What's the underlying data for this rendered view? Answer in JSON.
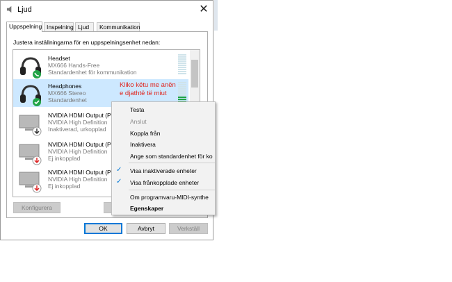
{
  "window": {
    "title": "Ljud",
    "close_glyph": "✕"
  },
  "tabs": [
    {
      "label": "Uppspelning",
      "active": true
    },
    {
      "label": "Inspelning",
      "active": false
    },
    {
      "label": "Ljud",
      "active": false
    },
    {
      "label": "Kommunikation",
      "active": false
    }
  ],
  "instruction": "Justera inställningarna för en uppspelningsenhet nedan:",
  "devices": [
    {
      "name": "Headset",
      "description": "MX666 Hands-Free",
      "status": "Standardenhet för kommunikation",
      "icon": "headset-icon",
      "badge": "phone-badge-icon",
      "selected": false
    },
    {
      "name": "Headphones",
      "description": "MX666 Stereo",
      "status": "Standardenhet",
      "icon": "headphones-icon",
      "badge": "check-badge-icon",
      "selected": true
    },
    {
      "name": "NVIDIA HDMI Output (P",
      "description": "NVIDIA High Definition",
      "status": "Inaktiverad, urkopplad",
      "icon": "monitor-icon",
      "badge": "down-arrow-badge-icon",
      "selected": false
    },
    {
      "name": "NVIDIA HDMI Output (P",
      "description": "NVIDIA High Definition",
      "status": "Ej inkopplad",
      "icon": "monitor-icon",
      "badge": "red-down-arrow-badge-icon",
      "selected": false
    },
    {
      "name": "NVIDIA HDMI Output (P",
      "description": "NVIDIA High Definition",
      "status": "Ej inkopplad",
      "icon": "monitor-icon",
      "badge": "red-down-arrow-badge-icon",
      "selected": false
    }
  ],
  "annotation": "Kliko këtu me anën e djathtë të miut",
  "context_menu": [
    {
      "label": "Testa",
      "disabled": false
    },
    {
      "label": "Anslut",
      "disabled": true
    },
    {
      "label": "Koppla från",
      "disabled": false
    },
    {
      "label": "Inaktivera",
      "disabled": false
    },
    {
      "label": "Ange som standardenhet för ko",
      "disabled": false
    },
    {
      "label": "Visa inaktiverade enheter",
      "checked": true
    },
    {
      "label": "Visa frånkopplade enheter",
      "checked": true
    },
    {
      "label": "Om programvaru-MIDI-synthe",
      "disabled": false
    },
    {
      "label": "Egenskaper",
      "bold": true
    }
  ],
  "buttons": {
    "configure": "Konfigurera",
    "ok": "OK",
    "cancel": "Avbryt",
    "apply": "Verkställ"
  },
  "colors": {
    "selection": "#cde8ff",
    "accent": "#0078d7",
    "annotation": "#e0241c",
    "meter_green": "#22a447"
  }
}
